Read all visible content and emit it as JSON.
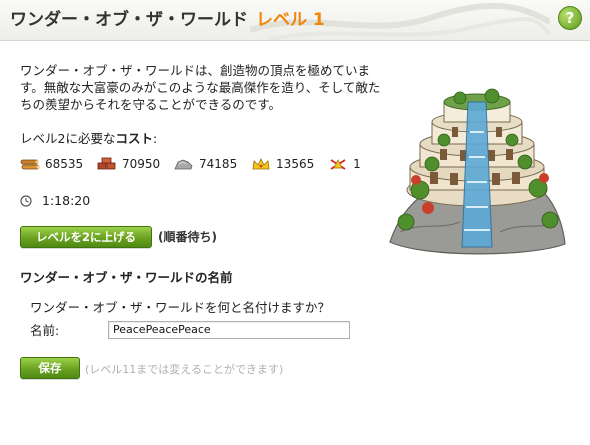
{
  "header": {
    "title": "ワンダー・オブ・ザ・ワールド",
    "level": "レベル 1",
    "help_label": "?"
  },
  "description": "ワンダー・オブ・ザ・ワールドは、創造物の頂点を極めています。無敵な大富豪のみがこのような最高傑作を造り、そして敵たちの羨望からそれを守ることができるのです。",
  "cost": {
    "label_prefix": "レベル2に必要な",
    "label_bold": "コスト",
    "label_suffix": ":",
    "items": [
      {
        "icon": "lumber-icon",
        "value": "68535"
      },
      {
        "icon": "brick-icon",
        "value": "70950"
      },
      {
        "icon": "stone-icon",
        "value": "74185"
      },
      {
        "icon": "gold-crown-icon",
        "value": "13565"
      },
      {
        "icon": "builder-icon",
        "value": "1"
      }
    ]
  },
  "timer": {
    "icon": "clock-icon",
    "value": "1:18:20"
  },
  "upgrade": {
    "button_label": "レベルを2に上げる",
    "queue_note": "(順番待ち)"
  },
  "naming": {
    "heading": "ワンダー・オブ・ザ・ワールドの名前",
    "question": "ワンダー・オブ・ザ・ワールドを何と名付けますか？",
    "field_label": "名前:",
    "field_value": "PeacePeacePeace",
    "save_label": "保存",
    "save_note": "(レベル11までは変えることができます)"
  },
  "colors": {
    "accent": "#f0860a",
    "button_green": "#6aa121"
  }
}
